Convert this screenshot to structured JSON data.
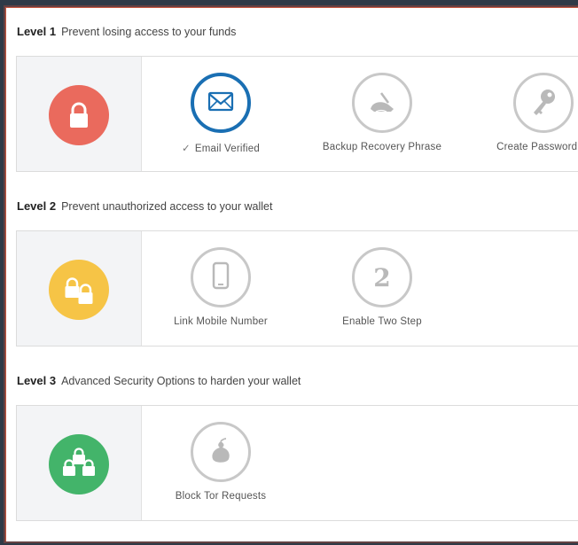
{
  "colors": {
    "level1": "#ea6a5d",
    "level2": "#f6c446",
    "level3": "#43b46a",
    "active_ring": "#1a6fb3",
    "inactive_ring": "#c8c8c8"
  },
  "levels": [
    {
      "label": "Level 1",
      "description": "Prevent losing access to your funds",
      "icon": "single-lock-icon",
      "steps": [
        {
          "label": "Email Verified",
          "check": "✓",
          "icon": "envelope-icon",
          "completed": true
        },
        {
          "label": "Backup Recovery Phrase",
          "icon": "ink-pen-icon",
          "completed": false
        },
        {
          "label": "Create Password Hi",
          "icon": "key-icon",
          "completed": false
        }
      ]
    },
    {
      "label": "Level 2",
      "description": "Prevent unauthorized access to your wallet",
      "icon": "double-lock-icon",
      "steps": [
        {
          "label": "Link Mobile Number",
          "icon": "mobile-phone-icon",
          "completed": false
        },
        {
          "label": "Enable Two Step",
          "icon": "number-two-icon",
          "completed": false
        }
      ]
    },
    {
      "label": "Level 3",
      "description": "Advanced Security Options to harden your wallet",
      "icon": "triple-lock-icon",
      "steps": [
        {
          "label": "Block Tor Requests",
          "icon": "onion-icon",
          "completed": false
        }
      ]
    }
  ]
}
